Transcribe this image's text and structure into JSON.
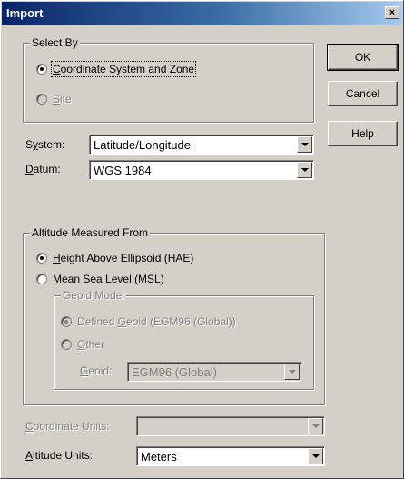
{
  "window": {
    "title": "Import",
    "close_glyph": "×"
  },
  "buttons": {
    "ok": "OK",
    "cancel": "Cancel",
    "help": "Help"
  },
  "select_by": {
    "legend": "Select By",
    "options": [
      {
        "u": "C",
        "rest": "oordinate System and Zone",
        "checked": true,
        "disabled": false
      },
      {
        "u": "S",
        "rest": "ite",
        "checked": false,
        "disabled": true
      }
    ]
  },
  "system": {
    "label_u": "y",
    "label_pre": "S",
    "label_post": "stem:",
    "value": "Latitude/Longitude"
  },
  "datum": {
    "label_u": "D",
    "label_post": "atum:",
    "value": "WGS 1984"
  },
  "altitude": {
    "legend": "Altitude Measured From",
    "options": [
      {
        "u": "H",
        "rest": "eight Above Ellipsoid (HAE)",
        "checked": true
      },
      {
        "u": "M",
        "rest": "ean Sea Level (MSL)",
        "checked": false
      }
    ]
  },
  "geoid_model": {
    "legend": "Geoid Model",
    "defined": {
      "pre": "Defined ",
      "u": "G",
      "rest": "eoid (EGM96 (Global))",
      "checked": true
    },
    "other": {
      "u": "O",
      "rest": "ther",
      "checked": false
    },
    "geoid_label_u": "G",
    "geoid_label_rest": "eoid:",
    "geoid_value": "EGM96 (Global)"
  },
  "coordinate_units": {
    "label_u": "C",
    "label_rest": "oordinate Units:",
    "value": ""
  },
  "altitude_units": {
    "label_u": "A",
    "label_rest": "ltitude Units:",
    "value": "Meters"
  }
}
